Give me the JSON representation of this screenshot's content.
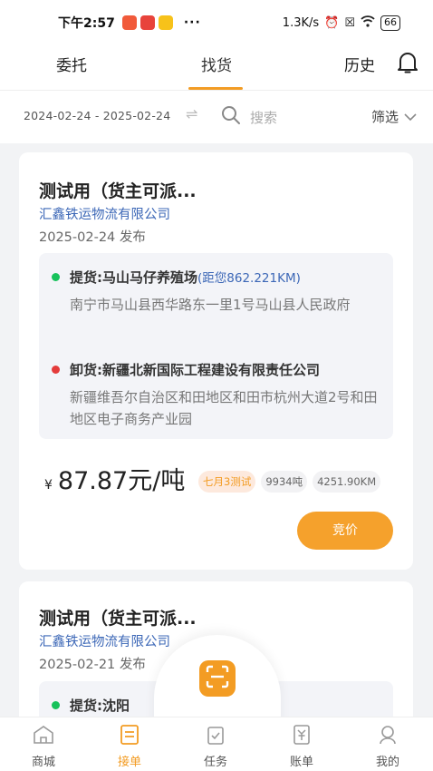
{
  "statusbar": {
    "time": "下午2:57",
    "dots": "···",
    "network": "1.3K/s",
    "battery": "66"
  },
  "tabs": [
    {
      "label": "委托"
    },
    {
      "label": "找货"
    },
    {
      "label": "历史"
    }
  ],
  "filter": {
    "date_range": "2024-02-24 - 2025-02-24",
    "search_placeholder": "搜索",
    "filter_label": "筛选"
  },
  "cards": [
    {
      "title": "测试用（货主可派...",
      "company": "汇鑫铁运物流有限公司",
      "date": "2025-02-24 发布",
      "pickup_label": "提货:",
      "pickup_name": "马山马仔养殖场",
      "pickup_distance": "(距您862.221KM)",
      "pickup_address": "南宁市马山县西华路东一里1号马山县人民政府",
      "unload_label": "卸货:",
      "unload_name": "新疆北新国际工程建设有限责任公司",
      "unload_address": "新疆维吾尔自治区和田地区和田市杭州大道2号和田地区电子商务产业园",
      "currency": "¥",
      "price": "87.87元/吨",
      "tags": [
        "七月3测试",
        "9934吨",
        "4251.90KM"
      ],
      "bid_label": "竞价"
    },
    {
      "title": "测试用（货主可派...",
      "company": "汇鑫铁运物流有限公司",
      "date": "2025-02-21 发布",
      "pickup_label": "提货:",
      "pickup_name": "沈阳"
    }
  ],
  "bottom_nav": [
    {
      "label": "商城"
    },
    {
      "label": "接单"
    },
    {
      "label": "任务"
    },
    {
      "label": "账单"
    },
    {
      "label": "我的"
    }
  ],
  "colors": {
    "accent": "#f39c23",
    "link": "#3d68b7",
    "pickup_dot": "#17c25b",
    "unload_dot": "#e43b3b"
  }
}
